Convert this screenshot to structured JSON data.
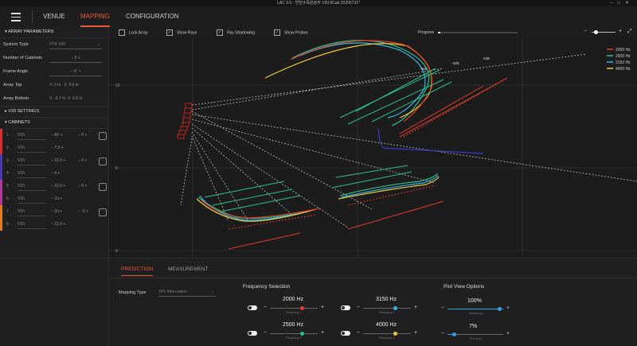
{
  "app": {
    "title": "LAC 3.5 - 연천수목원광주 V20 8Cab 20200731*"
  },
  "nav": {
    "tabs": [
      "VENUE",
      "MAPPING",
      "CONFIGURATION"
    ],
    "active": "MAPPING"
  },
  "sidebar": {
    "array_params_title": "ARRAY PARAMETERS",
    "system_type_label": "System Type",
    "system_type_value": "VTX V20",
    "num_cabinets_label": "Number of Cabinets",
    "num_cabinets_value": "8",
    "frame_angle_label": "Frame Angle",
    "frame_angle_value": "9°",
    "array_top_label": "Array Top",
    "array_top_x": "0 m",
    "array_top_z": "8.9 m",
    "array_bottom_label": "Array Bottom",
    "array_bottom_x": "-0.7 m",
    "array_bottom_z": "6.8 m",
    "v20_settings": "V20 SETTINGS",
    "cabinets_title": "CABINETS",
    "cabinets": [
      {
        "num": "1",
        "model": "V20",
        "angle": "AF",
        "val": "0",
        "color": "#d83030"
      },
      {
        "num": "2",
        "model": "V20",
        "angle": "7.5",
        "val": "",
        "color": "#d83030"
      },
      {
        "num": "3",
        "model": "V20",
        "angle": "12.5",
        "val": "0",
        "color": "#4a3ab0"
      },
      {
        "num": "4",
        "model": "V20",
        "angle": "4",
        "val": "",
        "color": "#4a3ab0"
      },
      {
        "num": "5",
        "model": "V20",
        "angle": "12.5",
        "val": "0",
        "color": "#b03a9a"
      },
      {
        "num": "6",
        "model": "V20",
        "angle": "10",
        "val": "",
        "color": "#b03a9a"
      },
      {
        "num": "7",
        "model": "V20",
        "angle": "10",
        "val": "-2",
        "color": "#e07a20"
      },
      {
        "num": "8",
        "model": "V20",
        "angle": "12.5",
        "val": "",
        "color": "#e07a20"
      }
    ]
  },
  "toolbar": {
    "lock_array": "Lock Array",
    "show_rays": "Show Rays",
    "ray_shadowing": "Ray Shadowing",
    "show_probes": "Show Probes",
    "progress_label": "Progress"
  },
  "plot": {
    "y_ticks": [
      "10",
      "6",
      "0"
    ],
    "x_ticks": [
      "0",
      "10",
      "20"
    ],
    "db_labels": [
      "-6dB",
      "-3dB",
      "0dB"
    ],
    "legend": [
      {
        "label": "2000 Hz",
        "color": "#e03a2a"
      },
      {
        "label": "2500 Hz",
        "color": "#2bbf8a"
      },
      {
        "label": "3150 Hz",
        "color": "#30b6e8"
      },
      {
        "label": "4000 Hz",
        "color": "#f0c640"
      }
    ]
  },
  "bottom": {
    "tabs": [
      "PREDICTION",
      "MEASUREMENT"
    ],
    "mapping_type_label": "Mapping Type",
    "mapping_type_value": "SPL Attenuation",
    "freq_sel_title": "Frequency Selection",
    "freqs": [
      {
        "value": "2000 Hz",
        "label": "Frequency 1",
        "color": "#e03a2a"
      },
      {
        "value": "3150 Hz",
        "label": "Frequency 3",
        "color": "#30b6e8"
      },
      {
        "value": "2500 Hz",
        "label": "Frequency 2",
        "color": "#2bbf8a"
      },
      {
        "value": "4000 Hz",
        "label": "Frequency 4",
        "color": "#f0c640"
      }
    ],
    "plot_view_title": "Plot View Options",
    "smoothing_value": "100%",
    "smoothing_label": "Smoothing",
    "plot_zoom_value": "7%",
    "plot_zoom_label": "Plot Zoom"
  }
}
